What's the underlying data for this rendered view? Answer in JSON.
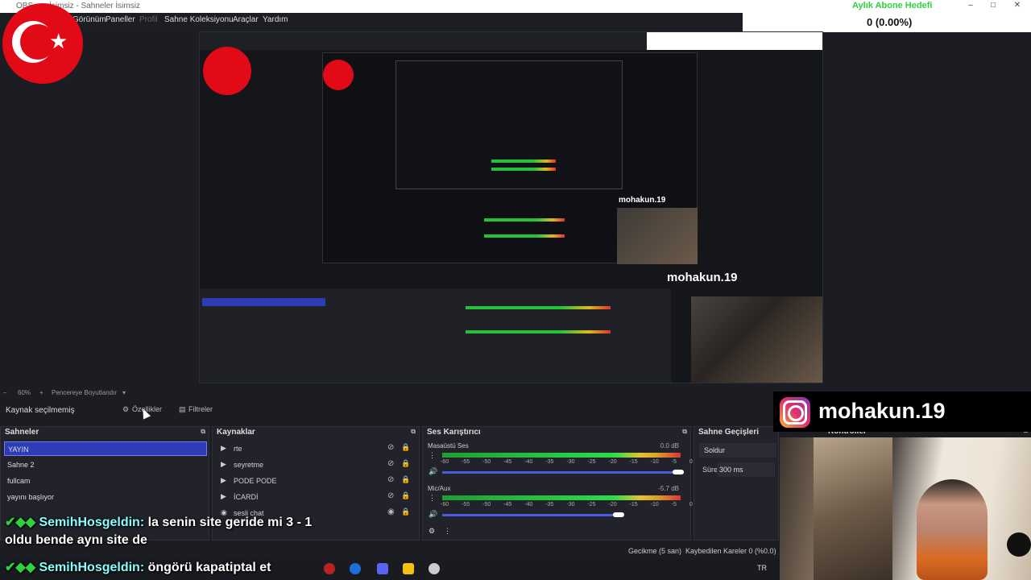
{
  "titlebar": {
    "title": "OBS ... - İsimsiz - Sahneler İsimsiz",
    "goal_title": "Aylık Abone Hedefi"
  },
  "goal": {
    "value": "0 (0.00%)"
  },
  "menu": {
    "items": [
      "Görünüm",
      "Paneller",
      "Profil",
      "Sahne Koleksiyonu",
      "Araçlar",
      "Yardım"
    ]
  },
  "zoom": {
    "level": "60%",
    "fit_label": "Pencereye Boyutlandır"
  },
  "source_bar": {
    "no_selection": "Kaynak seçilmemiş",
    "properties": "Özellikler",
    "filters": "Filtreler"
  },
  "scenes": {
    "title": "Sahneler",
    "items": [
      "YAYIN",
      "Sahne 2",
      "fullcam",
      "yayını başlıyor"
    ]
  },
  "sources": {
    "title": "Kaynaklar",
    "items": [
      "rte",
      "seyretme",
      "PODE PODE",
      "İCARDİ",
      "sesli chat"
    ]
  },
  "mixer": {
    "title": "Ses Karıştırıcı",
    "channels": [
      {
        "name": "Masaüstü Ses",
        "db": "0.0 dB"
      },
      {
        "name": "Mic/Aux",
        "db": "-5.7 dB"
      }
    ],
    "ticks": "-60 -55 -50 -45 -40 -35 -30 -25 -20 -15 -10 -5 0"
  },
  "transitions": {
    "title": "Sahne Geçişleri",
    "selected": "Soldur",
    "duration_label": "Süre",
    "duration_value": "300 ms"
  },
  "controls": {
    "title": "Kontroller"
  },
  "instagram": {
    "handle": "mohakun.19"
  },
  "chat": {
    "line1_user": "SemihHosgeldin:",
    "line1_text": "la senin site geride mi 3 - 1",
    "line2_text": "oldu bende aynı site de",
    "line3_user": "SemihHosgeldin:",
    "line3_text": "öngörü kapatiptal et"
  },
  "status": {
    "delay": "Gecikme (5 san)",
    "dropped": "Kaybedilen Kareler 0 (%0.0)"
  },
  "taskbar": {
    "lang": "TR"
  },
  "colors": {
    "accent": "#2d3db8",
    "goal_green": "#2fd13f",
    "flag_red": "#e30a17"
  }
}
